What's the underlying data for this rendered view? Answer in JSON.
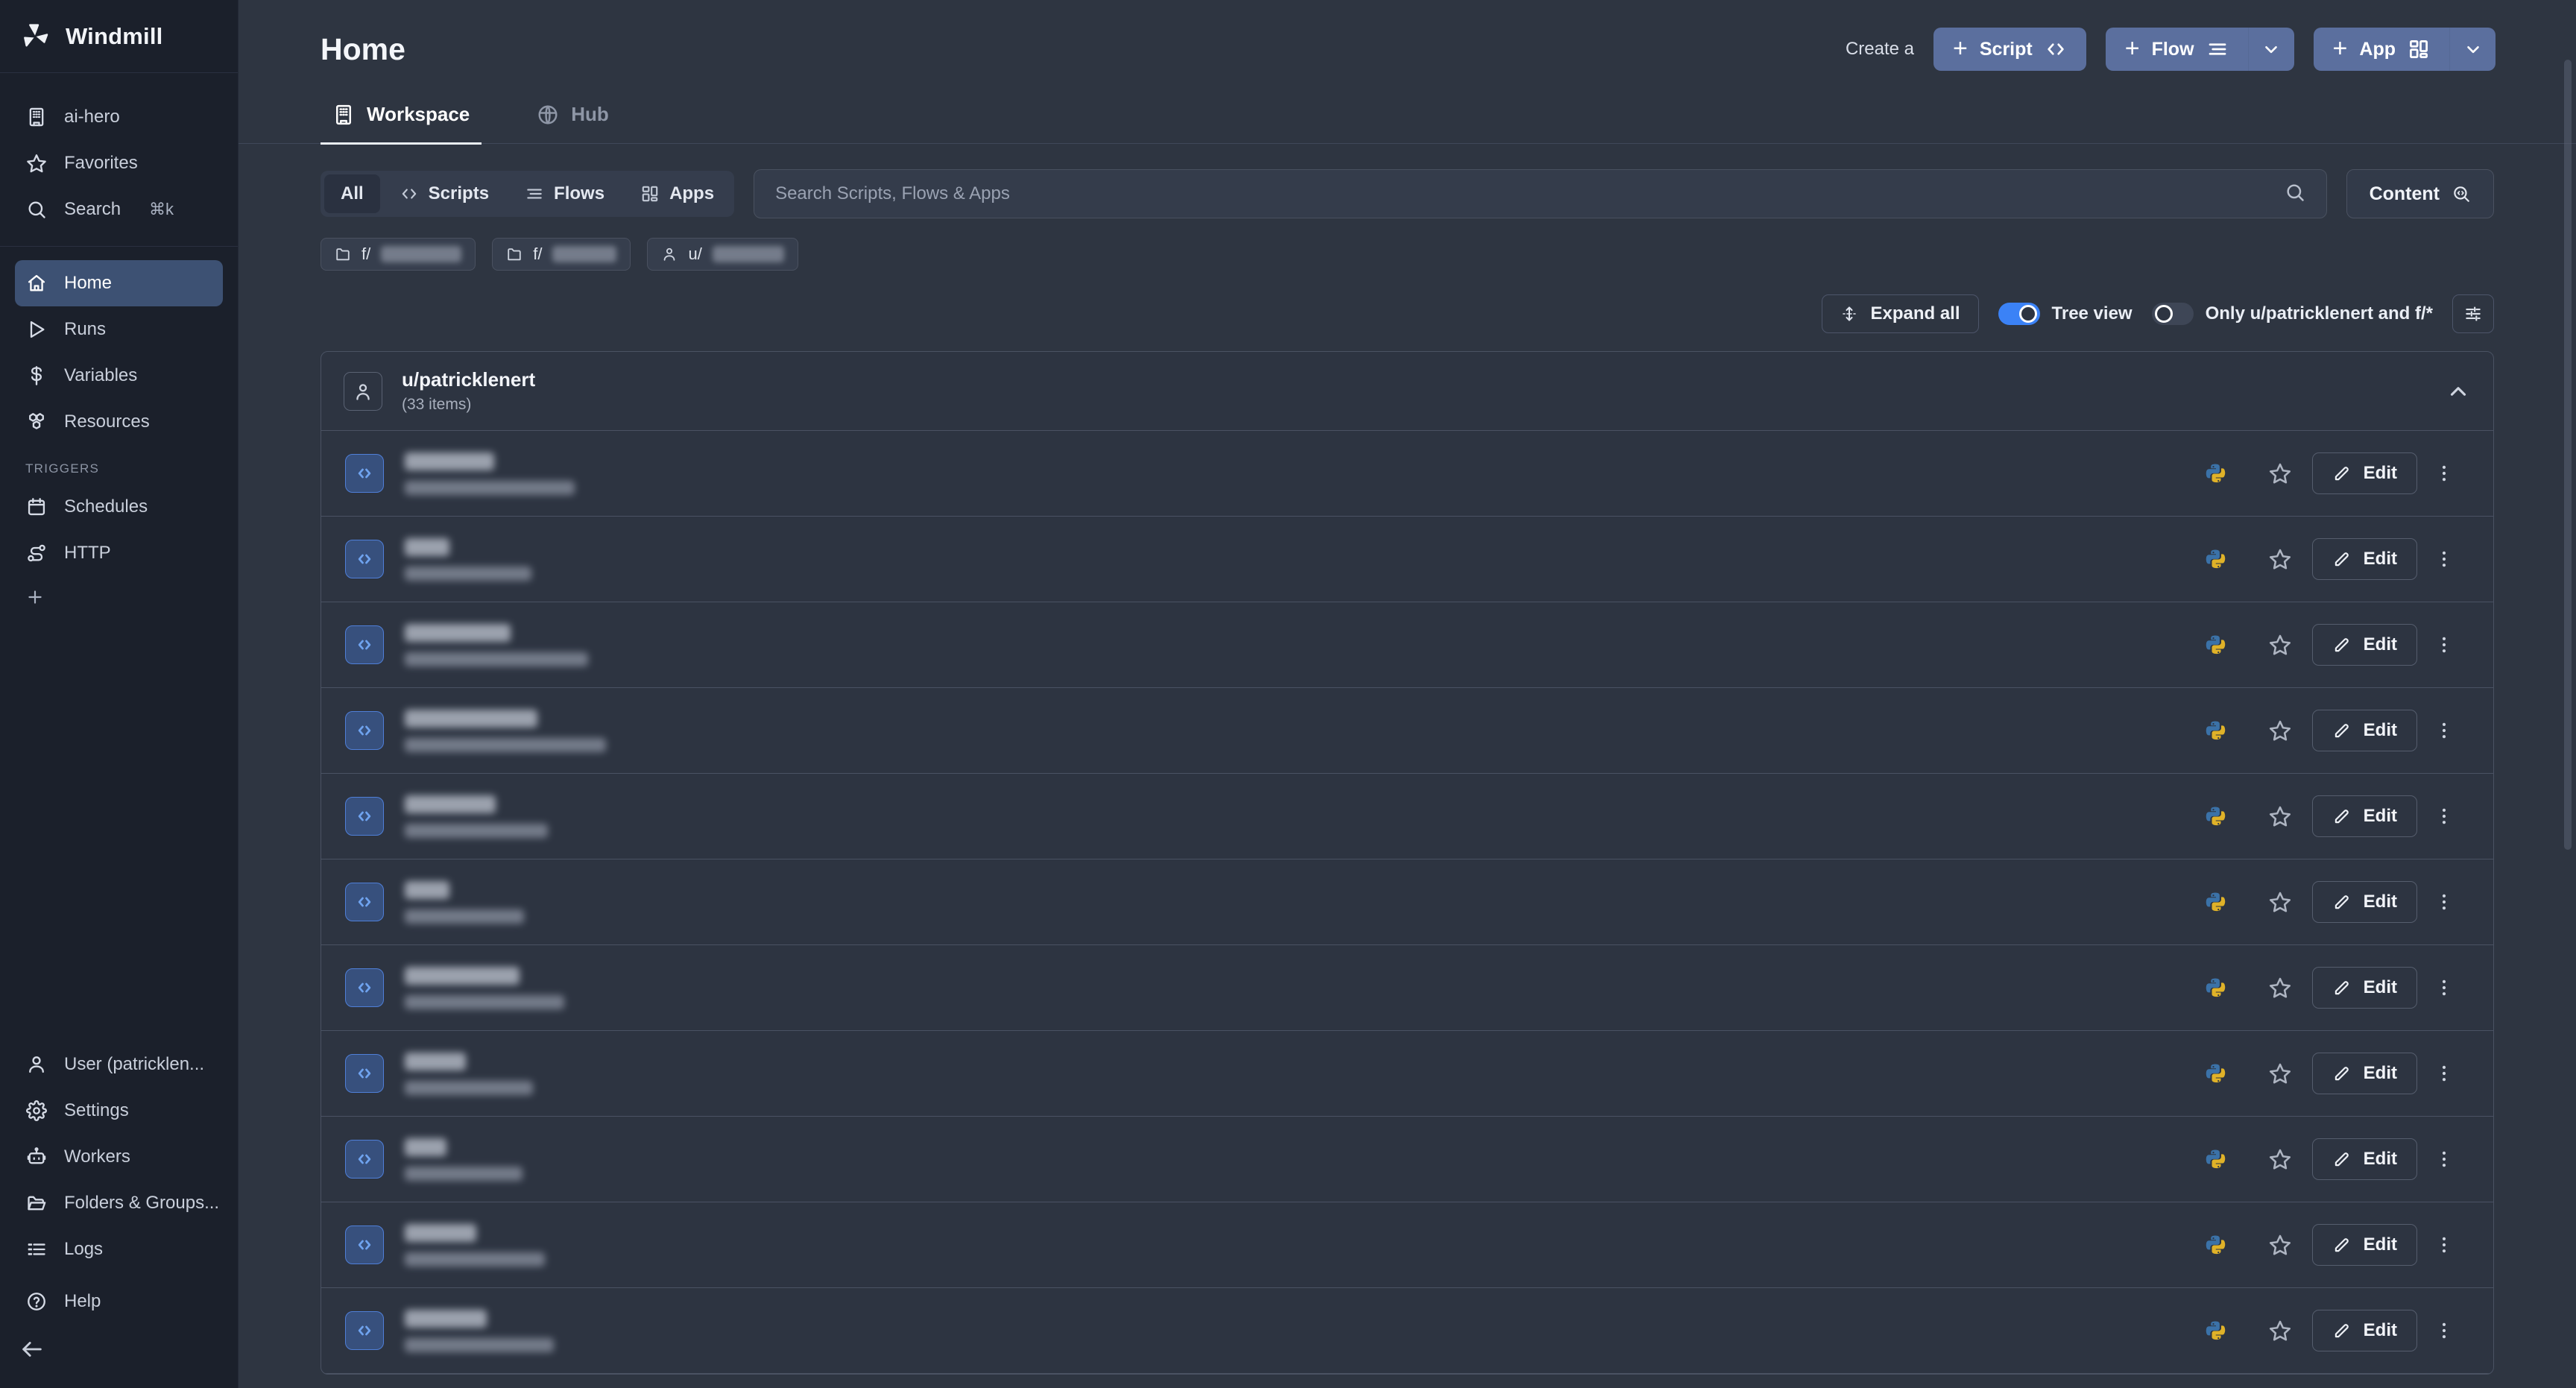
{
  "brand": {
    "name": "Windmill",
    "logo_icon": "windmill-logo-icon"
  },
  "sidebar": {
    "top_items": [
      {
        "label": "ai-hero",
        "icon": "building-icon",
        "name": "sidebar-item-workspace"
      },
      {
        "label": "Favorites",
        "icon": "star-icon",
        "name": "sidebar-item-favorites"
      },
      {
        "label": "Search",
        "icon": "search-icon",
        "name": "sidebar-item-search",
        "kbd": "⌘k"
      }
    ],
    "main_items": [
      {
        "label": "Home",
        "icon": "home-icon",
        "name": "sidebar-item-home",
        "active": true
      },
      {
        "label": "Runs",
        "icon": "play-icon",
        "name": "sidebar-item-runs",
        "active": false
      },
      {
        "label": "Variables",
        "icon": "dollar-icon",
        "name": "sidebar-item-variables",
        "active": false
      },
      {
        "label": "Resources",
        "icon": "boxes-icon",
        "name": "sidebar-item-resources",
        "active": false
      }
    ],
    "triggers_label": "TRIGGERS",
    "trigger_items": [
      {
        "label": "Schedules",
        "icon": "calendar-icon",
        "name": "sidebar-item-schedules"
      },
      {
        "label": "HTTP",
        "icon": "route-icon",
        "name": "sidebar-item-http"
      }
    ],
    "bottom_items": [
      {
        "label": "User (patricklen...",
        "icon": "user-icon",
        "name": "sidebar-item-user"
      },
      {
        "label": "Settings",
        "icon": "gear-icon",
        "name": "sidebar-item-settings"
      },
      {
        "label": "Workers",
        "icon": "robot-icon",
        "name": "sidebar-item-workers"
      },
      {
        "label": "Folders & Groups...",
        "icon": "folder-icon",
        "name": "sidebar-item-folders-groups"
      },
      {
        "label": "Logs",
        "icon": "list-icon",
        "name": "sidebar-item-logs"
      }
    ],
    "help_item": {
      "label": "Help",
      "icon": "question-circle-icon",
      "name": "sidebar-item-help"
    }
  },
  "header": {
    "title": "Home",
    "create_a_label": "Create a",
    "script_button": "Script",
    "flow_button": "Flow",
    "app_button": "App"
  },
  "tabs": [
    {
      "label": "Workspace",
      "icon": "building-icon",
      "active": true
    },
    {
      "label": "Hub",
      "icon": "globe-icon",
      "active": false
    }
  ],
  "filters": {
    "segments": [
      {
        "label": "All",
        "icon": null,
        "active": true
      },
      {
        "label": "Scripts",
        "icon": "code-icon",
        "active": false
      },
      {
        "label": "Flows",
        "icon": "flow-icon",
        "active": false
      },
      {
        "label": "Apps",
        "icon": "grid-icon",
        "active": false
      }
    ],
    "search_placeholder": "Search Scripts, Flows & Apps",
    "search_value": "",
    "content_button": "Content"
  },
  "chips": [
    {
      "prefix": "f/",
      "icon": "folder-icon",
      "redacted": true,
      "redacted_width": 108
    },
    {
      "prefix": "f/",
      "icon": "folder-icon",
      "redacted": true,
      "redacted_width": 86
    },
    {
      "prefix": "u/",
      "icon": "user-icon",
      "redacted": true,
      "redacted_width": 96
    }
  ],
  "toolbar": {
    "expand_all": "Expand all",
    "tree_view_label": "Tree view",
    "tree_view_on": true,
    "only_user_label": "Only u/patricklenert and f/*",
    "only_user_on": false,
    "filter_icon": "sliders-icon"
  },
  "group": {
    "name": "u/patricklenert",
    "count": "(33 items)",
    "avatar_icon": "user-icon",
    "chevron_icon": "chevron-up-icon",
    "expanded": true
  },
  "rows": [
    {
      "kind": "script",
      "lang": "python",
      "edit_label": "Edit",
      "name_width": 120,
      "path_width": 228
    },
    {
      "kind": "script",
      "lang": "python",
      "edit_label": "Edit",
      "name_width": 60,
      "path_width": 170
    },
    {
      "kind": "script",
      "lang": "python",
      "edit_label": "Edit",
      "name_width": 142,
      "path_width": 246
    },
    {
      "kind": "script",
      "lang": "python",
      "edit_label": "Edit",
      "name_width": 178,
      "path_width": 270
    },
    {
      "kind": "script",
      "lang": "python",
      "edit_label": "Edit",
      "name_width": 122,
      "path_width": 192
    },
    {
      "kind": "script",
      "lang": "python",
      "edit_label": "Edit",
      "name_width": 60,
      "path_width": 160
    },
    {
      "kind": "script",
      "lang": "python",
      "edit_label": "Edit",
      "name_width": 154,
      "path_width": 214
    },
    {
      "kind": "script",
      "lang": "python",
      "edit_label": "Edit",
      "name_width": 82,
      "path_width": 172
    },
    {
      "kind": "script",
      "lang": "python",
      "edit_label": "Edit",
      "name_width": 56,
      "path_width": 158
    },
    {
      "kind": "script",
      "lang": "python",
      "edit_label": "Edit",
      "name_width": 96,
      "path_width": 188
    },
    {
      "kind": "script",
      "lang": "python",
      "edit_label": "Edit",
      "name_width": 110,
      "path_width": 200
    }
  ]
}
